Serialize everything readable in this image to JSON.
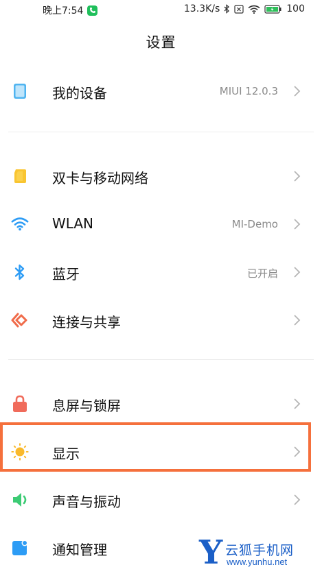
{
  "status_bar": {
    "time": "晚上7:54",
    "speed": "13.3K/s",
    "battery": "100"
  },
  "page": {
    "title": "设置"
  },
  "items": [
    {
      "label": "我的设备",
      "value": "MIUI 12.0.3",
      "icon": "device-icon"
    },
    {
      "label": "双卡与移动网络",
      "value": "",
      "icon": "sim-card-icon"
    },
    {
      "label": "WLAN",
      "value": "MI-Demo",
      "icon": "wifi-icon"
    },
    {
      "label": "蓝牙",
      "value": "已开启",
      "icon": "bluetooth-icon"
    },
    {
      "label": "连接与共享",
      "value": "",
      "icon": "connection-share-icon"
    },
    {
      "label": "息屏与锁屏",
      "value": "",
      "icon": "lock-icon"
    },
    {
      "label": "显示",
      "value": "",
      "icon": "sun-icon"
    },
    {
      "label": "声音与振动",
      "value": "",
      "icon": "speaker-icon"
    },
    {
      "label": "通知管理",
      "value": "",
      "icon": "notification-icon"
    }
  ],
  "colors": {
    "highlight": "#f5703c",
    "device_icon": "#4fb4f0",
    "sim_icon": "#f9c531",
    "wifi_icon": "#2d9cf5",
    "bluetooth_icon": "#2d9cf5",
    "share_icon": "#f06b4a",
    "lock_icon": "#f06b5b",
    "sun_icon": "#f9b92c",
    "speaker_icon": "#3ccb74",
    "notify_icon": "#2d9cf5"
  },
  "watermark": {
    "letter": "Y",
    "name": "云狐手机网",
    "url": "www.yunhu.net"
  }
}
